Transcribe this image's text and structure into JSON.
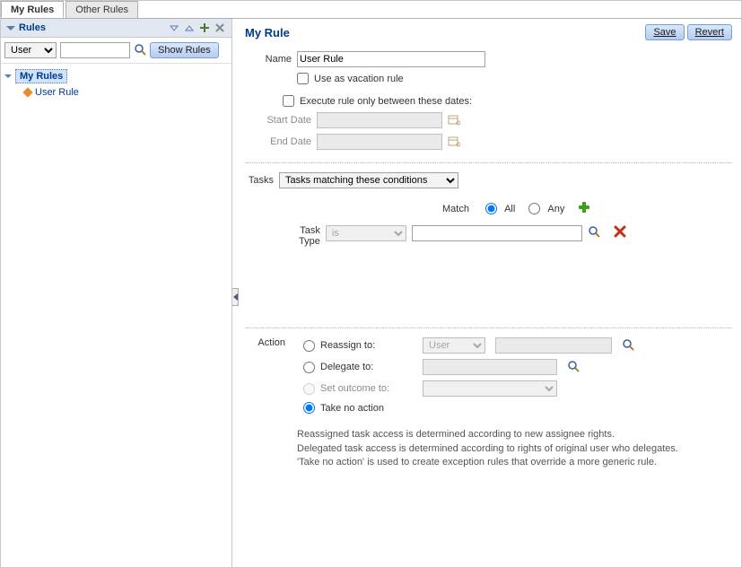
{
  "tabs": {
    "my_rules": "My Rules",
    "other_rules": "Other Rules"
  },
  "sidebar": {
    "title": "Rules",
    "filter_type": "User",
    "filter_value": "",
    "show_rules_btn": "Show Rules",
    "tree_root": "My Rules",
    "tree_item": "User Rule"
  },
  "page": {
    "title": "My Rule",
    "save": "Save",
    "revert": "Revert"
  },
  "form": {
    "name_label": "Name",
    "name_value": "User Rule",
    "vacation_label": "Use as vacation rule",
    "date_range_label": "Execute rule only between these dates:",
    "start_date_label": "Start Date",
    "end_date_label": "End Date",
    "tasks_label": "Tasks",
    "tasks_select": "Tasks matching these conditions",
    "match_label": "Match",
    "match_all": "All",
    "match_any": "Any",
    "task_type_label_1": "Task",
    "task_type_label_2": "Type",
    "task_type_op": "is",
    "action_label": "Action",
    "reassign": "Reassign to:",
    "reassign_type": "User",
    "delegate": "Delegate to:",
    "outcome": "Set outcome to:",
    "noaction": "Take no action",
    "help1": "Reassigned task access is determined according to new assignee rights.",
    "help2": "Delegated task access is determined according to rights of original user who delegates.",
    "help3": "'Take no action' is used to create exception rules that override a more generic rule."
  }
}
